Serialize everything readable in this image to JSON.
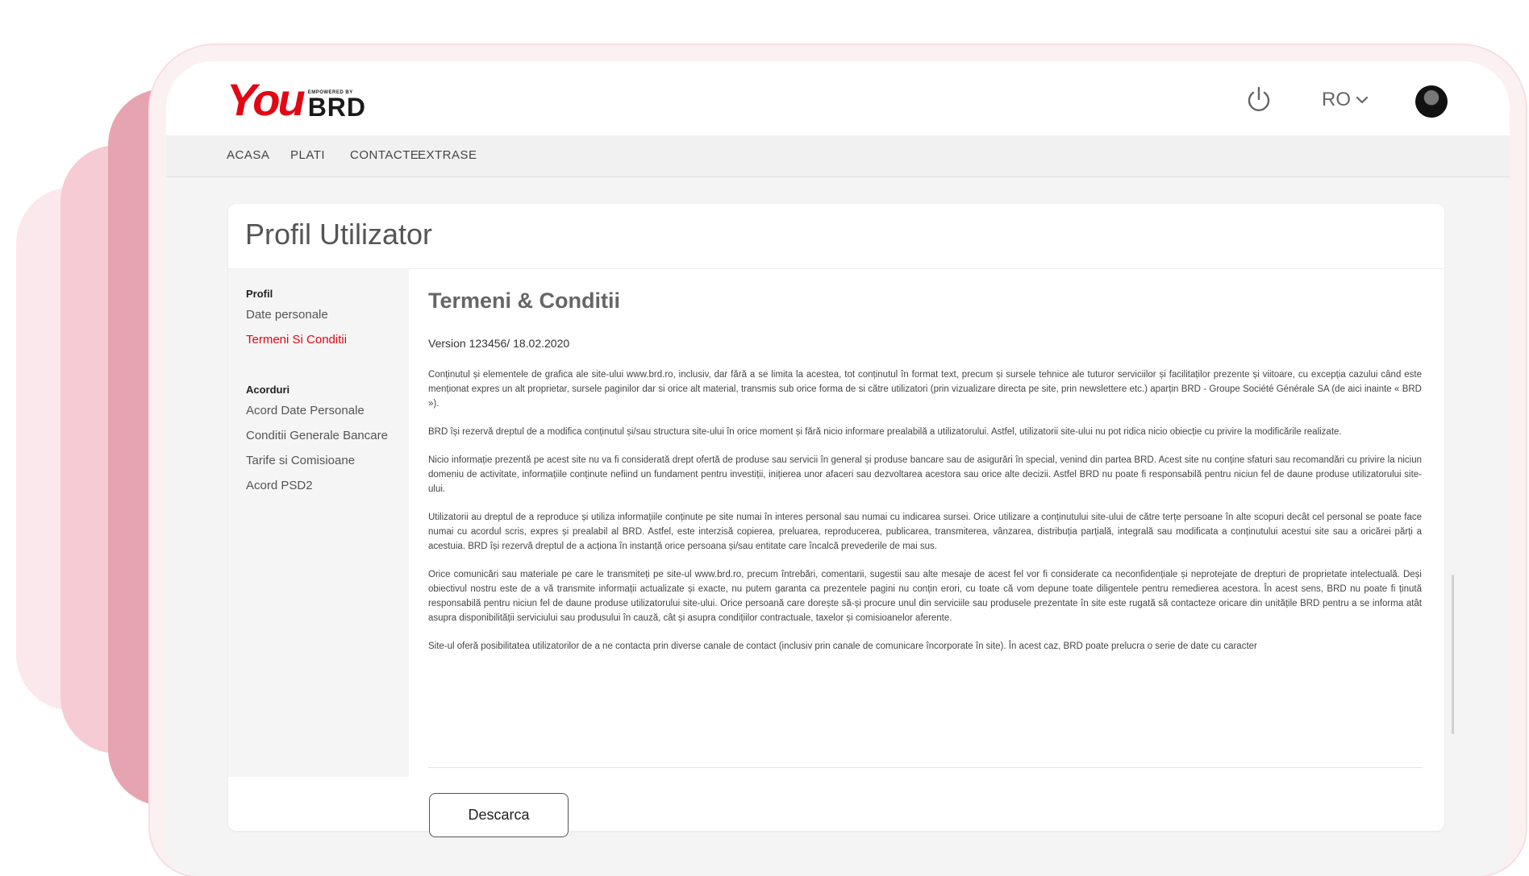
{
  "header": {
    "logo_you": "You",
    "logo_tagline": "EMPOWERED BY",
    "logo_brd": "BRD",
    "power_icon": "power-icon",
    "language": "RO",
    "language_icon": "chevron-down-icon",
    "avatar_icon": "user-avatar"
  },
  "nav": {
    "items": [
      "ACASA",
      "PLATI",
      "CONTACTE",
      "EXTRASE"
    ]
  },
  "page": {
    "title": "Profil Utilizator"
  },
  "sidebar": {
    "profile_heading": "Profil",
    "profile_items": [
      "Date personale",
      "Termeni Si Conditii"
    ],
    "active_item": "Termeni Si Conditii",
    "agreements_heading": "Acorduri",
    "agreement_items": [
      "Acord Date Personale",
      "Conditii Generale Bancare",
      "Tarife si Comisioane",
      "Acord PSD2"
    ]
  },
  "content": {
    "title": "Termeni & Conditii",
    "version": "Version 123456/ 18.02.2020",
    "paragraphs": [
      "Conținutul și elementele de grafica ale site-ului www.brd.ro, inclusiv, dar fără a se limita la acestea, tot conținutul în format text, precum și sursele tehnice ale tuturor serviciilor și facilitaților prezente și viitoare, cu excepția cazului când este menționat expres un alt proprietar, sursele paginilor dar si orice alt material, transmis sub orice forma de si către utilizatori (prin vizualizare directa pe site, prin newslettere etc.) aparțin BRD - Groupe Société Générale SA (de aici inainte « BRD »).",
      "BRD își rezervă dreptul de a modifica conținutul și/sau structura site-ului în orice moment și fără nicio informare prealabilă a utilizatorului. Astfel, utilizatorii site-ului nu pot ridica nicio obiecție cu privire la modificările realizate.",
      "Nicio informație prezentă pe acest site nu va fi considerată drept ofertă de produse sau servicii în general și produse bancare sau de asigurări în special, venind din partea BRD. Acest site nu conține sfaturi sau recomandări cu privire la niciun domeniu de activitate, informațiile conținute nefiind un fundament pentru investiții, inițierea unor afaceri sau dezvoltarea acestora sau orice alte decizii. Astfel BRD nu poate fi responsabilă pentru niciun fel de daune produse utilizatorului site-ului.",
      "Utilizatorii au dreptul de a reproduce și utiliza informațiile conținute pe site numai în interes personal sau numai cu indicarea sursei. Orice utilizare a conținutului site-ului de către terțe persoane în alte scopuri decât cel personal se poate face numai cu acordul scris, expres și prealabil al BRD. Astfel, este interzisă copierea, preluarea, reproducerea, publicarea, transmiterea, vânzarea, distribuția parțială, integrală sau modificata a conținutului acestui site sau a oricărei părți a acestuia. BRD își rezervă dreptul de a acționa în instanță orice persoana și/sau entitate care încalcă prevederile de mai sus.",
      "Orice comunicări sau materiale pe care le transmiteți pe site-ul www.brd.ro, precum întrebări, comentarii, sugestii sau alte mesaje de acest fel vor fi considerate ca neconfidențiale și neprotejate de drepturi de proprietate intelectuală. Deși obiectivul nostru este de a vă transmite informații actualizate și exacte, nu putem garanta ca prezentele pagini nu conțin erori, cu toate că vom depune toate diligentele pentru remedierea acestora. În acest sens, BRD nu poate fi ținută responsabilă pentru niciun fel de daune produse utilizatorului site-ului. Orice persoană care dorește să-și procure unul din serviciile sau produsele prezentate în site este rugată să contacteze oricare din unitățile BRD pentru a se informa atât asupra disponibilității serviciului sau produsului în cauză, cât și asupra condițiilor contractuale, taxelor și comisioanelor aferente.",
      "Site-ul oferă posibilitatea utilizatorilor de a ne contacta prin diverse canale de contact (inclusiv prin canale de comunicare încorporate în site). În acest caz, BRD poate prelucra o serie de date cu caracter"
    ],
    "download_label": "Descarca"
  }
}
